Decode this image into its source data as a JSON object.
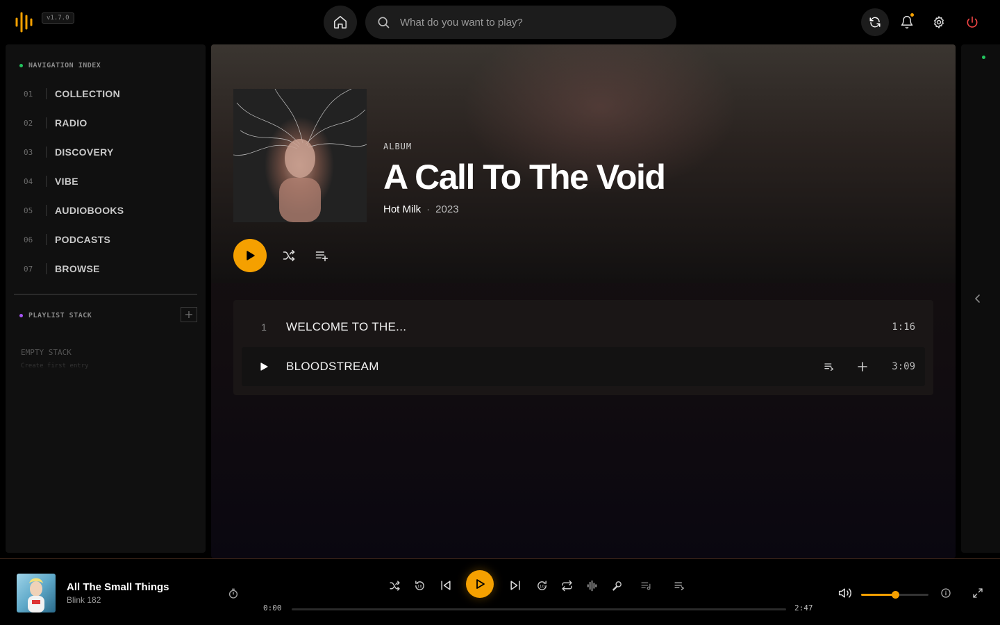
{
  "app": {
    "version": "v1.7.0"
  },
  "search": {
    "placeholder": "What do you want to play?"
  },
  "sidebar": {
    "nav_heading": "NAVIGATION INDEX",
    "items": [
      {
        "num": "01",
        "label": "COLLECTION"
      },
      {
        "num": "02",
        "label": "RADIO"
      },
      {
        "num": "03",
        "label": "DISCOVERY"
      },
      {
        "num": "04",
        "label": "VIBE"
      },
      {
        "num": "05",
        "label": "AUDIOBOOKS"
      },
      {
        "num": "06",
        "label": "PODCASTS"
      },
      {
        "num": "07",
        "label": "BROWSE"
      }
    ],
    "playlist_heading": "PLAYLIST STACK",
    "empty_title": "EMPTY STACK",
    "empty_subtitle": "Create first entry"
  },
  "album": {
    "type": "ALBUM",
    "title": "A Call To The Void",
    "artist": "Hot Milk",
    "separator": "·",
    "year": "2023"
  },
  "tracks": [
    {
      "number": "1",
      "title": "WELCOME TO THE...",
      "duration": "1:16"
    },
    {
      "number": "",
      "title": "BLOODSTREAM",
      "duration": "3:09"
    }
  ],
  "now_playing": {
    "title": "All The Small Things",
    "artist": "Blink 182",
    "current_time": "0:00",
    "total_time": "2:47",
    "progress": 0.0,
    "volume": 0.5
  },
  "colors": {
    "accent": "#f5a000",
    "nav_dot": "#22c55e",
    "playlist_dot": "#a855f7",
    "power": "#ef4444"
  }
}
